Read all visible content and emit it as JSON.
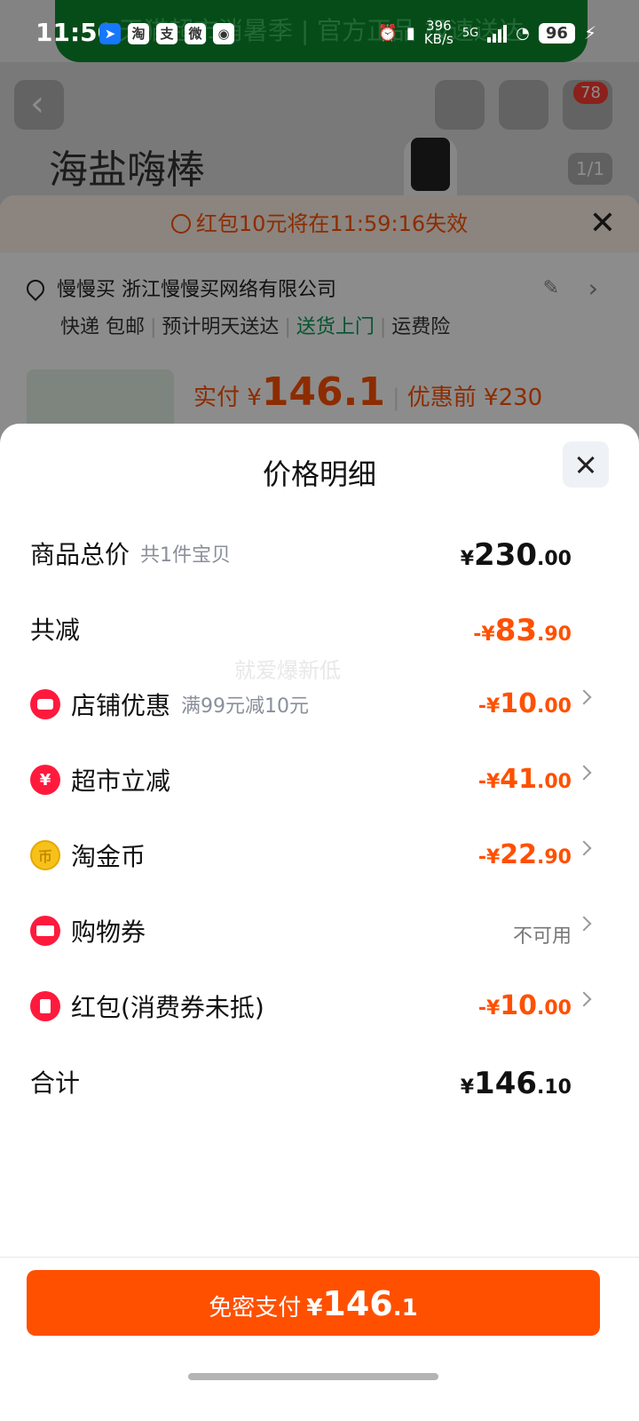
{
  "status_bar": {
    "time": "11:50",
    "app_icons": [
      "淘",
      "支",
      "微",
      "微博"
    ],
    "net_speed": "396",
    "net_unit": "KB/s",
    "net_type": "5G",
    "battery": "96"
  },
  "background_page": {
    "banner_text": "天猫超市消暑季 | 官方正品 极速送达",
    "product_title": "海盐嗨棒",
    "cart_badge": "78",
    "image_pager": "1/1",
    "red_packet_warning": "红包10元将在11:59:16失效",
    "address": "慢慢买 浙江慢慢买网络有限公司",
    "shipping": [
      "快递 包邮",
      "预计明天送达",
      "送货上门",
      "运费险"
    ],
    "pay_label": "实付 ¥",
    "pay_value": "146.1",
    "before_label": "优惠前 ¥230"
  },
  "price_sheet": {
    "title": "价格明细",
    "watermark": "就爱爆新低",
    "rows": [
      {
        "label": "商品总价",
        "sub": "共1件宝贝",
        "prefix": "¥",
        "main": "230",
        "decimal": ".00"
      },
      {
        "label": "共减",
        "sub": "",
        "prefix": "-¥",
        "main": "83",
        "decimal": ".90"
      },
      {
        "label": "店铺优惠",
        "sub": "满99元减10元",
        "prefix": "-¥",
        "main": "10",
        "decimal": ".00",
        "icon": "shop-discount-icon"
      },
      {
        "label": "超市立减",
        "sub": "",
        "prefix": "-¥",
        "main": "41",
        "decimal": ".00",
        "icon": "yen-coupon-icon"
      },
      {
        "label": "淘金币",
        "sub": "",
        "prefix": "-¥",
        "main": "22",
        "decimal": ".90",
        "icon": "gold-coin-icon"
      },
      {
        "label": "购物券",
        "sub": "",
        "value_text": "不可用",
        "icon": "shopping-voucher-icon"
      },
      {
        "label": "红包(消费券未抵)",
        "sub": "",
        "prefix": "-¥",
        "main": "10",
        "decimal": ".00",
        "icon": "red-packet-icon"
      },
      {
        "label": "合计",
        "sub": "",
        "prefix": "¥",
        "main": "146",
        "decimal": ".10"
      }
    ]
  },
  "pay_button": {
    "label": "免密支付",
    "prefix": "¥",
    "main": "146",
    "decimal": ".1"
  },
  "colors": {
    "accent": "#ff5000",
    "text": "#111111",
    "muted": "#8a8f9a"
  }
}
